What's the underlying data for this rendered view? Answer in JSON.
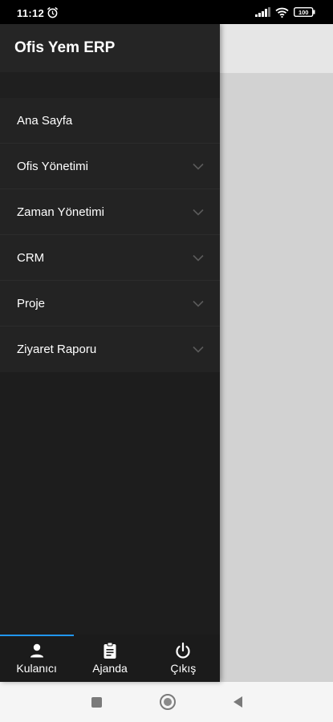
{
  "status_bar": {
    "time": "11:12",
    "battery": "100"
  },
  "drawer": {
    "title": "Ofis Yem ERP",
    "menu": [
      {
        "label": "Ana Sayfa",
        "expandable": false
      },
      {
        "label": "Ofis Yönetimi",
        "expandable": true
      },
      {
        "label": "Zaman Yönetimi",
        "expandable": true
      },
      {
        "label": "CRM",
        "expandable": true
      },
      {
        "label": "Proje",
        "expandable": true
      },
      {
        "label": "Ziyaret Raporu",
        "expandable": true
      }
    ]
  },
  "bottom_nav": {
    "items": [
      {
        "label": "Kulanıcı",
        "icon": "person-icon",
        "active": true
      },
      {
        "label": "Ajanda",
        "icon": "clipboard-icon",
        "active": false
      },
      {
        "label": "Çıkış",
        "icon": "power-icon",
        "active": false
      }
    ],
    "accent": "#2196f3"
  },
  "colors": {
    "drawer_bg": "#1d1d1d",
    "scrim": "#d0d0d0"
  }
}
